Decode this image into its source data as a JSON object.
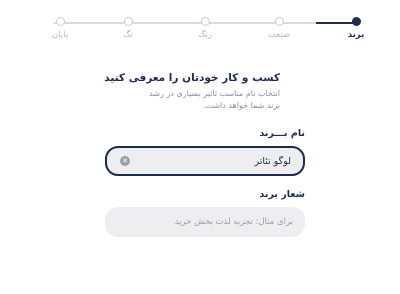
{
  "stepper": {
    "steps": [
      {
        "label": "برند",
        "active": true
      },
      {
        "label": "صنعت",
        "active": false
      },
      {
        "label": "رنگ",
        "active": false
      },
      {
        "label": "تگ",
        "active": false
      },
      {
        "label": "پایان",
        "active": false
      }
    ]
  },
  "intro": {
    "title": "کسب و کار خودتان را معرفی کنید",
    "description": "انتخاب نام مناسب تاثیر بسیاری در رشد برند شما خواهد داشت."
  },
  "brand_name": {
    "label": "نام بـــرند",
    "value": "لوگو تئاتر",
    "clear_icon": "clear-icon"
  },
  "brand_slogan": {
    "label": "شعار برند",
    "placeholder": "برای مثال: تجربه لذت بخش خرید",
    "value": ""
  },
  "colors": {
    "primary": "#1e2a4f",
    "field_bg": "#eeeef0",
    "inactive": "#c9ccd4"
  }
}
